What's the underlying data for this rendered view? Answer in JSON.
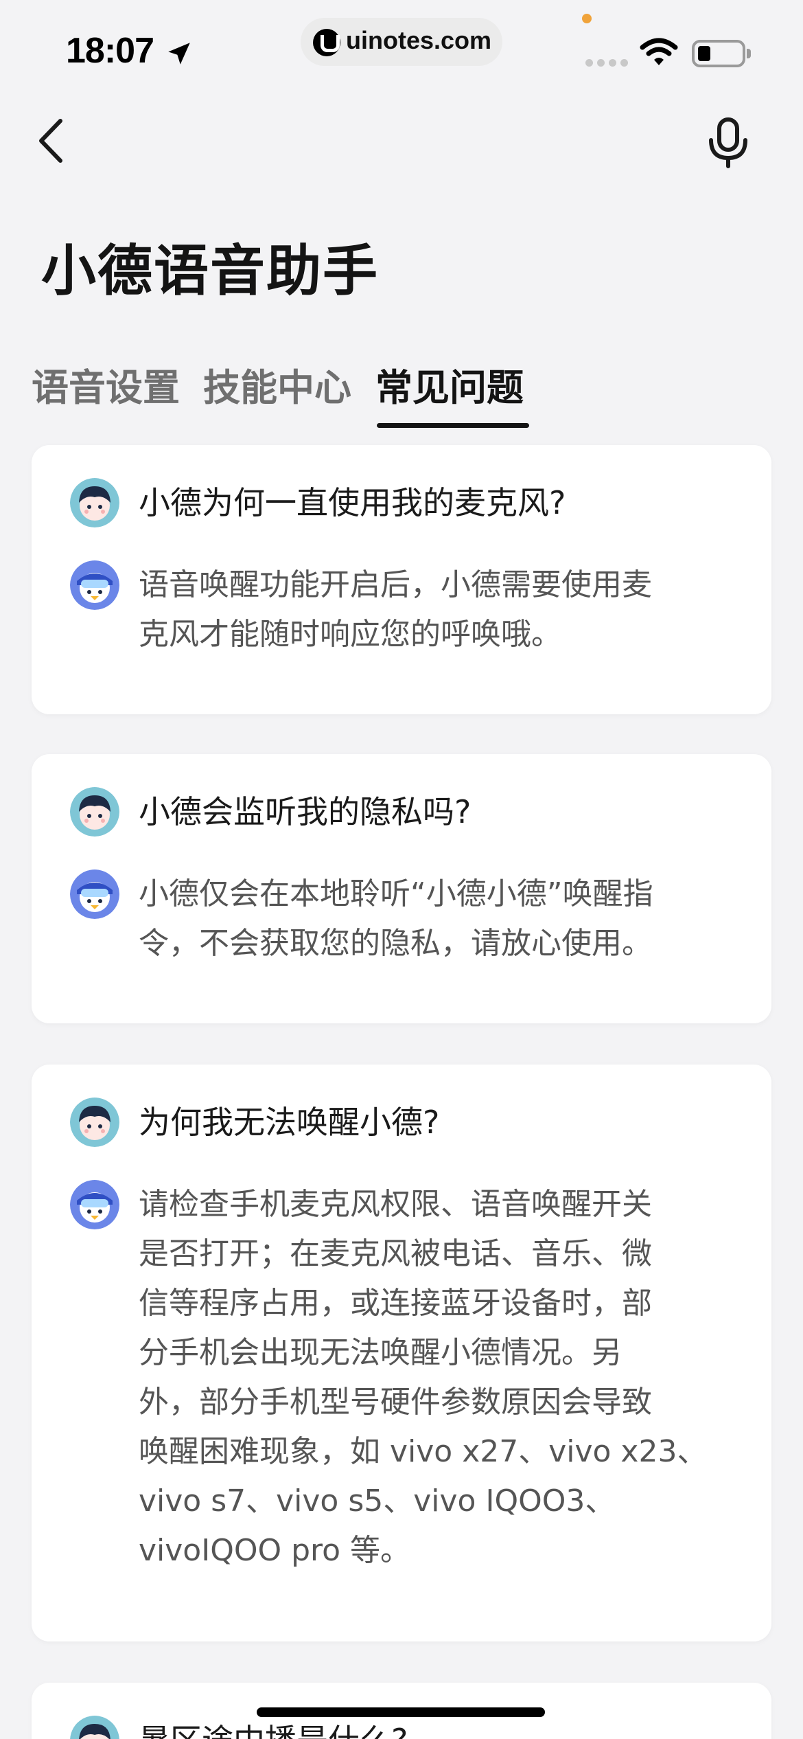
{
  "status_bar": {
    "time": "18:07",
    "url": "uinotes.com",
    "icons": [
      "location-arrow-icon",
      "uinotes-logo-icon",
      "wifi-icon",
      "battery-icon"
    ],
    "battery_level": 0.25
  },
  "header": {
    "title": "小德语音助手",
    "icons": [
      "back-arrow-icon",
      "microphone-icon"
    ]
  },
  "tabs": [
    {
      "label": "语音设置",
      "active": false
    },
    {
      "label": "技能中心",
      "active": false
    },
    {
      "label": "常见问题",
      "active": true
    }
  ],
  "faq": [
    {
      "question": "小德为何一直使用我的麦克风?",
      "answer": "语音唤醒功能开启后，小德需要使用麦\n克风才能随时响应您的呼唤哦。"
    },
    {
      "question": "小德会监听我的隐私吗?",
      "answer": "小德仅会在本地聆听“小德小德”唤醒指\n令，不会获取您的隐私，请放心使用。"
    },
    {
      "question": "为何我无法唤醒小德?",
      "answer": "请检查手机麦克风权限、语音唤醒开关\n是否打开；在麦克风被电话、音乐、微\n信等程序占用，或连接蓝牙设备时，部\n分手机会出现无法唤醒小德情况。另\n外，部分手机型号硬件参数原因会导致\n唤醒困难现象，如 vivo x27、vivo x23、\nvivo s7、vivo s5、vivo IQOO3、\nvivoIQOO pro 等。"
    },
    {
      "question": "暑区途中播是什么?",
      "answer": ""
    }
  ],
  "colors": {
    "background": "#f3f3f5",
    "card": "#ffffff",
    "text_primary": "#1a1a1a",
    "text_secondary": "#555555",
    "tab_inactive": "#6f6f6f",
    "avatar_user_bg": "#7fc6d6",
    "avatar_assistant_bg": "#6b86e8"
  }
}
